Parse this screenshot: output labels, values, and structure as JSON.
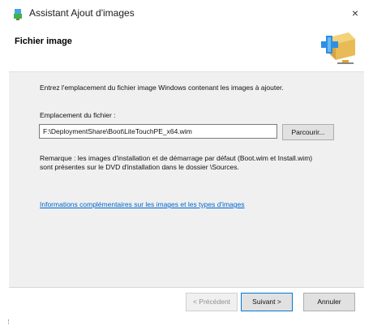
{
  "window": {
    "title": "Assistant Ajout d'images",
    "close_glyph": "×"
  },
  "header": {
    "title": "Fichier image",
    "icon": "wizard-add-image-icon"
  },
  "content": {
    "description": "Entrez l'emplacement du fichier image Windows contenant les images à ajouter.",
    "location_label": "Emplacement du fichier :",
    "location_value": "F:\\DeploymentShare\\Boot\\LiteTouchPE_x64.wim",
    "browse_label": "Parcourir...",
    "note": "Remarque : les images d'installation et de démarrage par défaut (Boot.wim et Install.wim) sont présentes sur le DVD d'installation dans le dossier \\Sources.",
    "info_link": "Informations complémentaires sur les images et les types d'images"
  },
  "footer": {
    "prev_label": "< Précédent",
    "next_label": "Suivant >",
    "cancel_label": "Annuler"
  },
  "colors": {
    "link": "#0066cc",
    "panel_bg": "#f0f0f0",
    "focus_border": "#0078d7"
  }
}
